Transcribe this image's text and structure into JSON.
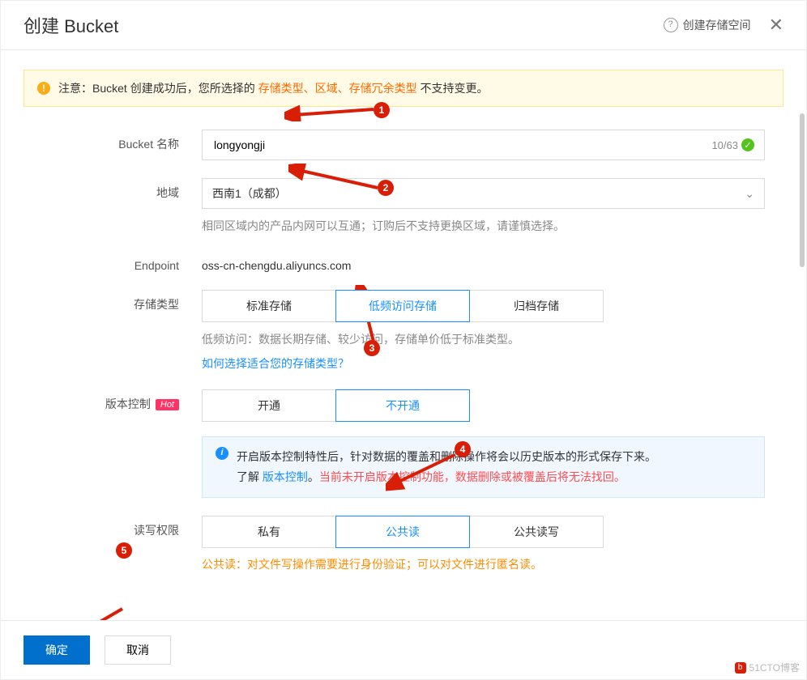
{
  "header": {
    "title": "创建 Bucket",
    "help_label": "创建存储空间"
  },
  "notice": {
    "prefix": "注意：Bucket 创建成功后，您所选择的 ",
    "h1": "存储类型",
    "sep1": "、",
    "h2": "区域",
    "sep2": "、",
    "h3": "存储冗余类型",
    "suffix": " 不支持变更。"
  },
  "labels": {
    "bucket_name": "Bucket 名称",
    "region": "地域",
    "endpoint": "Endpoint",
    "storage_type": "存储类型",
    "versioning": "版本控制",
    "acl": "读写权限",
    "confirm": "确定",
    "cancel": "取消"
  },
  "bucket": {
    "value": "longyongji",
    "counter": "10/63"
  },
  "region": {
    "selected": "西南1（成都）",
    "hint": "相同区域内的产品内网可以互通；订购后不支持更换区域，请谨慎选择。"
  },
  "endpoint": {
    "value": "oss-cn-chengdu.aliyuncs.com"
  },
  "storage": {
    "opt_standard": "标准存储",
    "opt_ia": "低频访问存储",
    "opt_archive": "归档存储",
    "hint": "低频访问：数据长期存储、较少访问，存储单价低于标准类型。",
    "link": "如何选择适合您的存储类型？"
  },
  "versioning": {
    "badge": "Hot",
    "opt_on": "开通",
    "opt_off": "不开通",
    "info_line1": "开启版本控制特性后，针对数据的覆盖和删除操作将会以历史版本的形式保存下来。",
    "info_line2a": "了解 ",
    "info_link": "版本控制",
    "info_line2b": "。",
    "info_red": "当前未开启版本控制功能，数据删除或被覆盖后将无法找回。"
  },
  "acl": {
    "opt_private": "私有",
    "opt_public_read": "公共读",
    "opt_public_rw": "公共读写",
    "hint": "公共读：对文件写操作需要进行身份验证；可以对文件进行匿名读。"
  },
  "watermark": "51CTO博客",
  "annotations": {
    "a1": "1",
    "a2": "2",
    "a3": "3",
    "a4": "4",
    "a5": "5"
  }
}
